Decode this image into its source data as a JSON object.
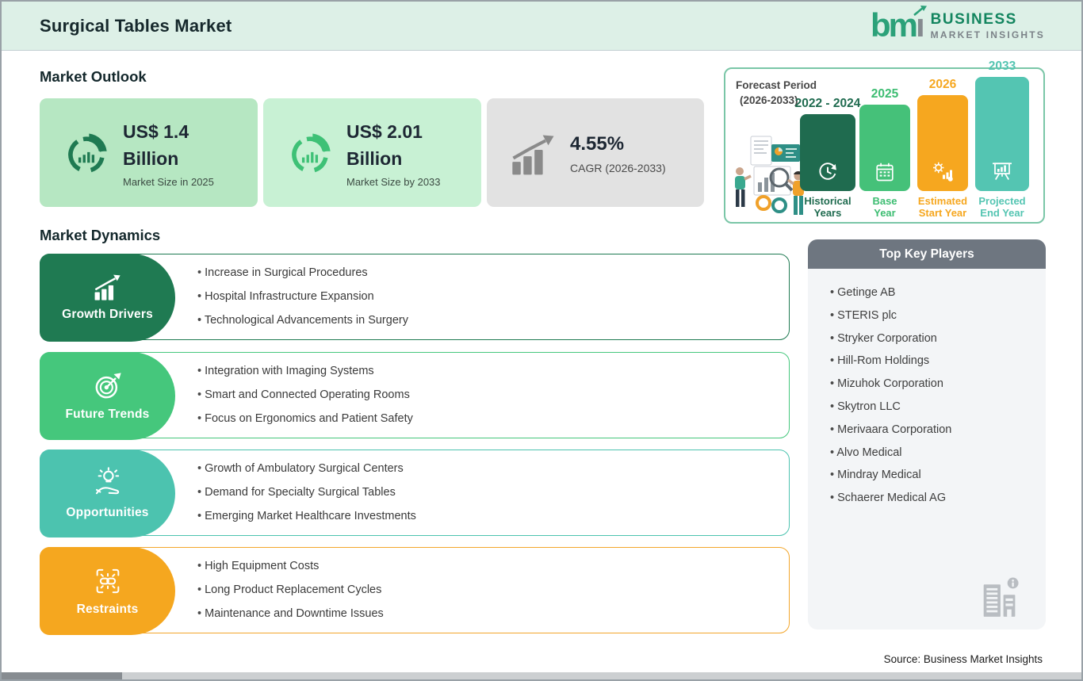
{
  "header": {
    "title": "Surgical Tables Market",
    "logo": {
      "mark": "bm",
      "mark_i": "ı",
      "line1": "BUSINESS",
      "line2": "MARKET INSIGHTS"
    }
  },
  "market_outlook": {
    "heading": "Market Outlook",
    "cards": [
      {
        "value_line1": "US$ 1.4",
        "value_line2": "Billion",
        "caption": "Market Size in 2025",
        "bg": "#b6e7c2",
        "icon": "donut-chart-icon",
        "icon_color": "#1f7a52"
      },
      {
        "value_line1": "US$ 2.01",
        "value_line2": "Billion",
        "caption": "Market Size by 2033",
        "bg": "#c8f1d4",
        "icon": "donut-chart-icon",
        "icon_color": "#3ec176"
      },
      {
        "value_line1": "4.55%",
        "value_line2": "",
        "caption": "CAGR (2026-2033)",
        "bg": "#e2e2e2",
        "icon": "growth-chart-icon",
        "icon_color": "#8a8a8a"
      }
    ]
  },
  "forecast": {
    "title_line1": "Forecast Period",
    "title_line2": "(2026-2033)",
    "bars": [
      {
        "year": "2022 - 2024",
        "label_line1": "Historical",
        "label_line2": "Years",
        "color": "#1f6b4f",
        "icon": "clock-history-icon"
      },
      {
        "year": "2025",
        "label_line1": "Base",
        "label_line2": "Year",
        "color": "#45c179",
        "icon": "calendar-icon"
      },
      {
        "year": "2026",
        "label_line1": "Estimated",
        "label_line2": "Start Year",
        "color": "#f6a71f",
        "icon": "gear-chart-icon"
      },
      {
        "year": "2033",
        "label_line1": "Projected",
        "label_line2": "End Year",
        "color": "#54c5b2",
        "icon": "presentation-chart-icon"
      }
    ]
  },
  "market_dynamics": {
    "heading": "Market Dynamics",
    "rows": [
      {
        "label": "Growth Drivers",
        "color": "#1f7a52",
        "icon": "growth-chart-icon",
        "bullets": [
          "Increase in Surgical Procedures",
          "Hospital Infrastructure Expansion",
          "Technological Advancements in Surgery"
        ]
      },
      {
        "label": "Future Trends",
        "color": "#45c77c",
        "icon": "target-dart-icon",
        "bullets": [
          "Integration with Imaging Systems",
          "Smart and Connected Operating Rooms",
          "Focus on Ergonomics and Patient Safety"
        ]
      },
      {
        "label": "Opportunities",
        "color": "#4cc3af",
        "icon": "idea-hand-icon",
        "bullets": [
          "Growth of Ambulatory Surgical Centers",
          "Demand for Specialty Surgical Tables",
          "Emerging Market Healthcare Investments"
        ]
      },
      {
        "label": "Restraints",
        "color": "#f5a71f",
        "icon": "chain-link-icon",
        "bullets": [
          "High Equipment Costs",
          "Long Product Replacement Cycles",
          "Maintenance and Downtime Issues"
        ]
      }
    ]
  },
  "key_players": {
    "heading": "Top Key Players",
    "items": [
      "Getinge AB",
      "STERIS plc",
      "Stryker Corporation",
      "Hill-Rom Holdings",
      "Mizuhok Corporation",
      "Skytron LLC",
      "Merivaara Corporation",
      "Alvo Medical",
      "Mindray Medical",
      "Schaerer Medical AG"
    ]
  },
  "source": "Source: Business Market Insights",
  "colors": {
    "header_bg": "#ddf0e7",
    "panel_border": "#7ac6a7",
    "players_header_bg": "#6e7680",
    "logo_green": "#2ba179"
  }
}
